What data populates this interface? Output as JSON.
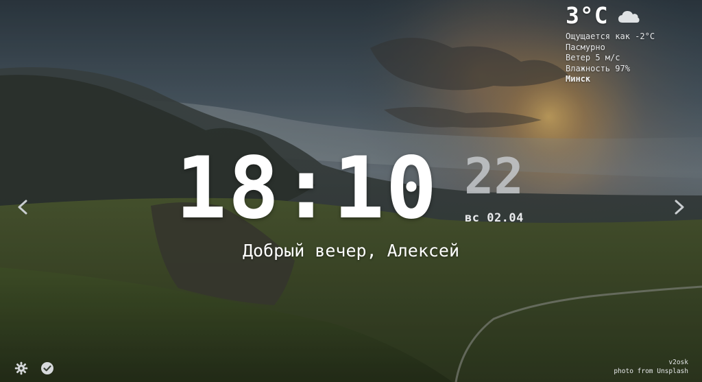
{
  "weather": {
    "temperature": "3°C",
    "icon": "cloud-icon",
    "feels_like": "Ощущается как -2°C",
    "condition": "Пасмурно",
    "wind": "Ветер 5 м/с",
    "humidity": "Влажность 97%",
    "city": "Минск"
  },
  "clock": {
    "time": "18:10",
    "seconds": "22",
    "date": "вс 02.04"
  },
  "greeting": "Добрый вечер, Алексей",
  "nav": {
    "prev_icon": "chevron-left-icon",
    "next_icon": "chevron-right-icon"
  },
  "footer": {
    "settings_icon": "gear-icon",
    "todo_icon": "check-circle-icon",
    "author": "v2osk",
    "source": "photo from Unsplash"
  },
  "colors": {
    "sky_dark": "#3c4850",
    "sunset_glow": "#e8b060",
    "hills": "#3c4a2c",
    "seconds_text": "#c8ccd0"
  }
}
